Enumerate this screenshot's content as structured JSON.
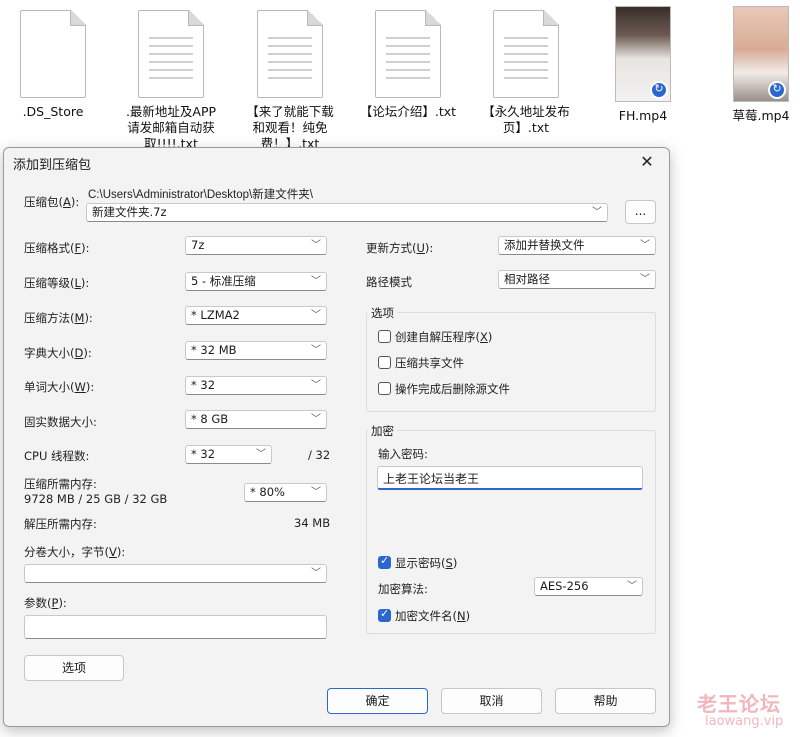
{
  "desktop": {
    "items": [
      {
        "label": ".DS_Store"
      },
      {
        "label": ".最新地址及APP\n请发邮箱自动获\n取!!!!.txt"
      },
      {
        "label": "【来了就能下载\n和观看！纯免\n费！】.txt"
      },
      {
        "label": "【论坛介绍】.txt"
      },
      {
        "label": "【永久地址发布\n页】.txt"
      },
      {
        "label": "FH.mp4"
      },
      {
        "label": "草莓.mp4"
      }
    ]
  },
  "dialog": {
    "title": "添加到压缩包",
    "archive": {
      "label": "压缩包(",
      "hotkey": "A",
      "label_end": "):",
      "path": "C:\\Users\\Administrator\\Desktop\\新建文件夹\\",
      "value": "新建文件夹.7z",
      "browse_label": "..."
    },
    "left": {
      "format": {
        "label": "压缩格式(",
        "hotkey": "F",
        "label_end": "):",
        "value": "7z"
      },
      "level": {
        "label": "压缩等级(",
        "hotkey": "L",
        "label_end": "):",
        "value": "5 - 标准压缩"
      },
      "method": {
        "label": "压缩方法(",
        "hotkey": "M",
        "label_end": "):",
        "value": "*  LZMA2"
      },
      "dict": {
        "label": "字典大小(",
        "hotkey": "D",
        "label_end": "):",
        "value": "*  32 MB"
      },
      "word": {
        "label": "单词大小(",
        "hotkey": "W",
        "label_end": "):",
        "value": "*  32"
      },
      "solid": {
        "label": "固实数据大小:",
        "value": "*  8 GB"
      },
      "threads": {
        "label": "CPU 线程数:",
        "value": "*  32",
        "max": "/ 32"
      },
      "mem": {
        "label": "压缩所需内存:",
        "detail": "9728 MB / 25 GB / 32 GB",
        "value": "*  80%"
      },
      "decomp": {
        "label": "解压所需内存:",
        "value": "34 MB"
      },
      "split": {
        "label": "分卷大小，字节(",
        "hotkey": "V",
        "label_end": "):",
        "value": ""
      },
      "params": {
        "label": "参数(",
        "hotkey": "P",
        "label_end": "):",
        "value": ""
      },
      "options_button": "选项"
    },
    "right": {
      "update": {
        "label": "更新方式(",
        "hotkey": "U",
        "label_end": "):",
        "value": "添加并替换文件"
      },
      "pathmode": {
        "label": "路径模式",
        "value": "相对路径"
      },
      "options": {
        "title": "选项",
        "sfx": {
          "label": "创建自解压程序(",
          "hotkey": "X",
          "label_end": ")",
          "checked": false
        },
        "shared": {
          "label": "压缩共享文件",
          "checked": false
        },
        "delete": {
          "label": "操作完成后删除源文件",
          "checked": false
        }
      },
      "encryption": {
        "title": "加密",
        "password_label": "输入密码:",
        "password_value": "上老王论坛当老王",
        "show_password": {
          "label": "显示密码(",
          "hotkey": "S",
          "label_end": ")",
          "checked": true
        },
        "method_label": "加密算法:",
        "method_value": "AES-256",
        "encrypt_names": {
          "label": "加密文件名(",
          "hotkey": "N",
          "label_end": ")",
          "checked": true
        }
      }
    },
    "buttons": {
      "ok": "确定",
      "cancel": "取消",
      "help": "帮助"
    }
  },
  "watermark": {
    "line1": "老王论坛",
    "line2": "laowang.vip"
  },
  "colors": {
    "accent": "#2b67d1",
    "dialog_bg": "#f3f3f3",
    "watermark": "#f0b7bd"
  }
}
